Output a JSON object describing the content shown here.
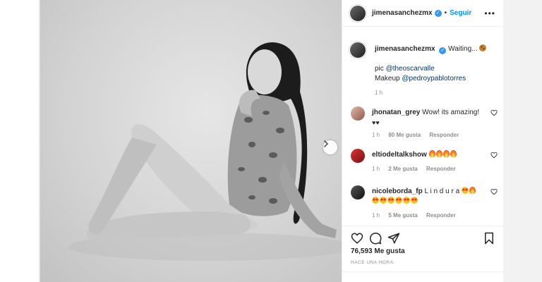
{
  "post": {
    "username": "jimenasanchezmx",
    "follow_label": "Seguir",
    "more_label": "•••",
    "caption": {
      "text": "Waiting...",
      "credit_prefix": "pic ",
      "credit_mention": "@theoscarvalle",
      "makeup_prefix": "Makeup ",
      "makeup_mention": "@pedroypablotorres",
      "time": "1 h"
    },
    "comments": [
      {
        "username": "jhonatan_grey",
        "text": "Wow! its amazing!",
        "time": "1 h",
        "likes": "80 Me gusta",
        "reply": "Responder"
      },
      {
        "username": "eltiodeltalkshow",
        "text": "",
        "time": "1 h",
        "likes": "2 Me gusta",
        "reply": "Responder"
      },
      {
        "username": "nicoleborda_fp",
        "text": "L i n d u r a",
        "time": "1 h",
        "likes": "5 Me gusta",
        "reply": "Responder"
      }
    ],
    "likes_count": "76,593 Me gusta",
    "time_ago": "HACE UNA HORA"
  },
  "icons": {
    "heart": "heart-icon",
    "comment": "comment-icon",
    "share": "share-icon",
    "save": "bookmark-icon",
    "next": "chevron-right-icon",
    "verified": "verified-badge-icon"
  },
  "colors": {
    "follow_blue": "#0095f6",
    "verified_blue": "#3897f0",
    "mention": "#00376b",
    "meta_gray": "#8e8e8e"
  }
}
